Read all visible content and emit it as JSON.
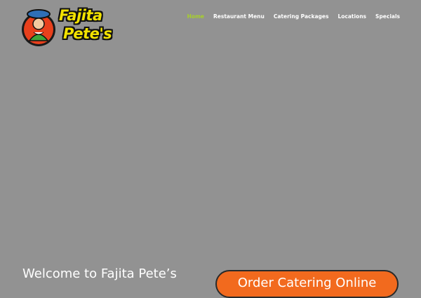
{
  "brand": {
    "logo_line1": "Fajita",
    "logo_line2": "Pete's",
    "logo_color": "#f2e200",
    "badge_color": "#e8401c"
  },
  "nav": {
    "items": [
      {
        "label": "Home",
        "active": true
      },
      {
        "label": "Restaurant Menu",
        "active": false
      },
      {
        "label": "Catering Packages",
        "active": false
      },
      {
        "label": "Locations",
        "active": false
      },
      {
        "label": "Specials",
        "active": false
      }
    ],
    "active_color": "#a7d129"
  },
  "hero": {
    "background": "#929292",
    "welcome_text": "Welcome to Fajita Pete’s",
    "cta_label": "Order Catering Online",
    "cta_color": "#f26a1e"
  }
}
